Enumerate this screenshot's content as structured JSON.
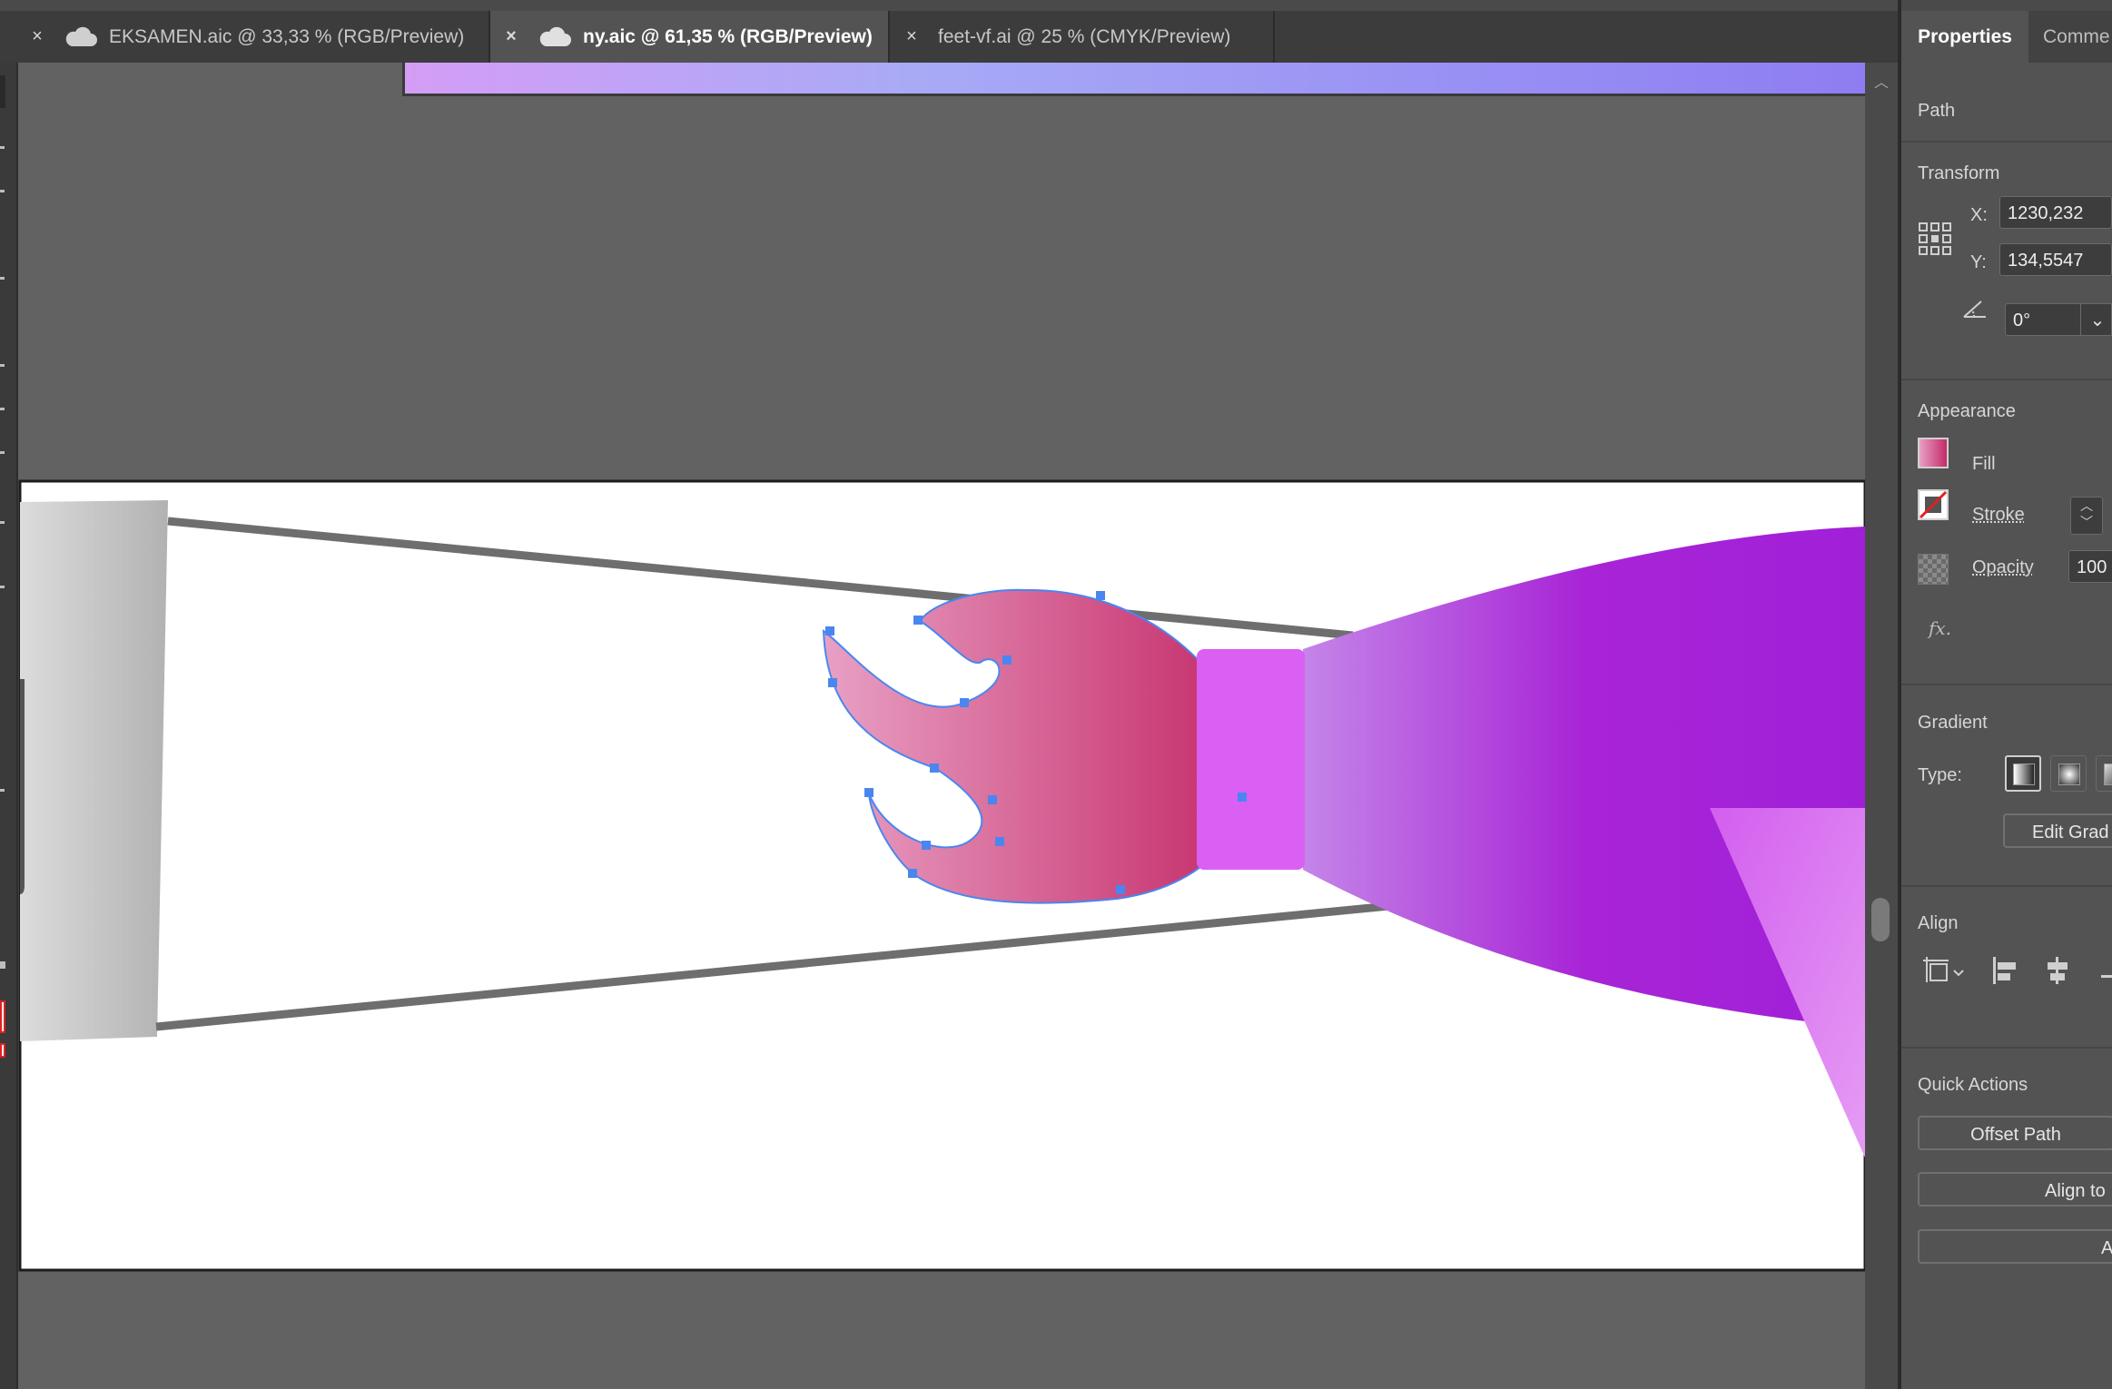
{
  "tabs": [
    {
      "label": "EKSAMEN.aic @ 33,33 % (RGB/Preview)",
      "active": false
    },
    {
      "label": "ny.aic @ 61,35 % (RGB/Preview)",
      "active": true
    },
    {
      "label": "feet-vf.ai @ 25 % (CMYK/Preview)",
      "active": false
    }
  ],
  "icons": {
    "close": "×",
    "cloud": "cloud-icon"
  },
  "panel": {
    "tabs": {
      "properties": "Properties",
      "comments": "Comme"
    },
    "selection_type": "Path",
    "transform": {
      "title": "Transform",
      "x_label": "X:",
      "x_value": "1230,232",
      "y_label": "Y:",
      "y_value": "134,5547",
      "rotate_value": "0°"
    },
    "appearance": {
      "title": "Appearance",
      "fill_label": "Fill",
      "stroke_label": "Stroke",
      "opacity_label": "Opacity",
      "opacity_value": "100",
      "fx_label": "fx."
    },
    "gradient": {
      "title": "Gradient",
      "type_label": "Type:",
      "edit_button": "Edit Grad"
    },
    "align": {
      "title": "Align"
    },
    "quick_actions": {
      "title": "Quick Actions",
      "offset_path": "Offset Path",
      "align_to": "Align to",
      "arrange": "Arr"
    }
  },
  "colors": {
    "fill_gradient_start": "#E8A0C4",
    "fill_gradient_end": "#C42A67",
    "ferrule": "#D960F3",
    "body_start": "#C485E8",
    "body_end": "#A020D8",
    "selection": "#4A86F0",
    "top_gradient_start": "#D49DF6",
    "top_gradient_end": "#8E7DF2"
  }
}
